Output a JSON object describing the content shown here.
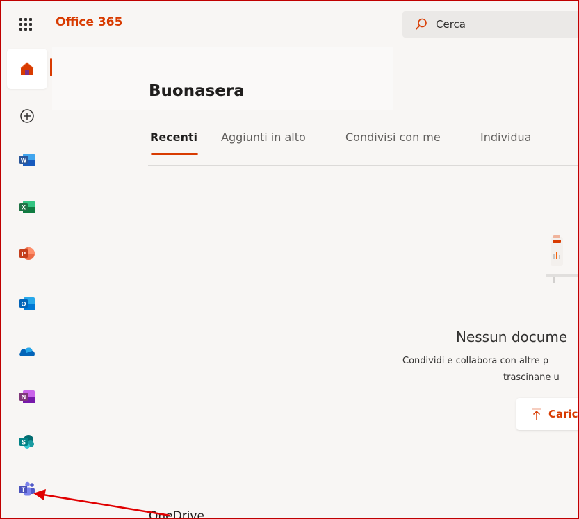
{
  "header": {
    "brand": "Office 365",
    "search_placeholder": "Cerca"
  },
  "main": {
    "greeting": "Buonasera",
    "tabs": [
      {
        "label": "Recenti"
      },
      {
        "label": "Aggiunti in alto"
      },
      {
        "label": "Condivisi con me"
      },
      {
        "label": "Individua"
      }
    ],
    "empty_state": {
      "title": "Nessun docume",
      "desc_line1": "Condividi e collabora con altre p",
      "desc_line2": "trascinane u",
      "upload_label": "Caric"
    },
    "section_label": "OneDrive"
  },
  "rail": {
    "items": [
      {
        "name": "home-icon"
      },
      {
        "name": "create-icon"
      },
      {
        "name": "word-icon"
      },
      {
        "name": "excel-icon"
      },
      {
        "name": "powerpoint-icon"
      },
      {
        "name": "outlook-icon"
      },
      {
        "name": "onedrive-icon"
      },
      {
        "name": "onenote-icon"
      },
      {
        "name": "sharepoint-icon"
      },
      {
        "name": "teams-icon"
      }
    ]
  },
  "colors": {
    "accent": "#d83b01",
    "annotation": "#e00000",
    "word": "#2b579a",
    "excel": "#217346",
    "powerpoint": "#d24726",
    "outlook": "#0078d4",
    "onedrive": "#0364b8",
    "onenote": "#7719aa",
    "sharepoint": "#038387",
    "teams": "#5059c9"
  }
}
